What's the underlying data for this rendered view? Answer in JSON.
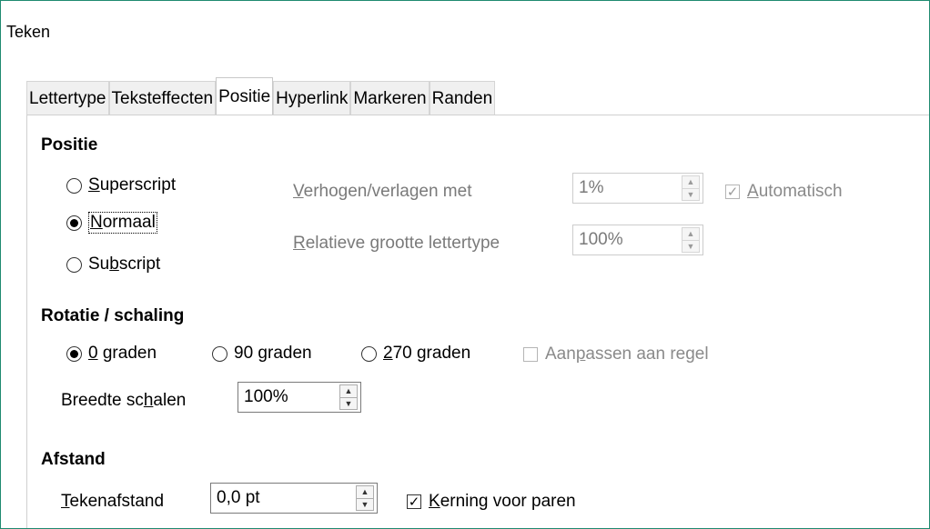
{
  "window": {
    "title": "Teken"
  },
  "tabs": [
    {
      "label": "Lettertype",
      "active": false
    },
    {
      "label": "Teksteffecten",
      "active": false
    },
    {
      "label": "Positie",
      "active": true
    },
    {
      "label": "Hyperlink",
      "active": false
    },
    {
      "label": "Markeren",
      "active": false
    },
    {
      "label": "Randen",
      "active": false
    }
  ],
  "positie": {
    "title": "Positie",
    "superscript": {
      "pre": "",
      "key": "S",
      "post": "uperscript"
    },
    "normaal": {
      "pre": "",
      "key": "N",
      "post": "ormaal"
    },
    "subscript": {
      "pre": "Su",
      "key": "b",
      "post": "script"
    },
    "selected": "Normaal",
    "raise": {
      "key": "V",
      "post": "erhogen/verlagen met",
      "value": "1%"
    },
    "relsize": {
      "key": "R",
      "post": "elatieve grootte lettertype",
      "value": "100%"
    },
    "auto": {
      "key": "A",
      "post": "utomatisch",
      "checked": true
    }
  },
  "rotatie": {
    "title": "Rotatie / schaling",
    "r0": {
      "key": "0",
      "post": " graden"
    },
    "r90": {
      "pre": "90 ",
      "key": "g",
      "post": "raden"
    },
    "r270": {
      "key": "2",
      "post": "70 graden"
    },
    "selected": "0 graden",
    "fit": {
      "pre": "Aan",
      "key": "p",
      "post": "assen aan regel",
      "checked": false
    },
    "scale": {
      "pre": "Breedte sc",
      "key": "h",
      "post": "alen",
      "value": "100%"
    }
  },
  "afstand": {
    "title": "Afstand",
    "spacing": {
      "key": "T",
      "post": "ekenafstand",
      "value": "0,0 pt"
    },
    "kerning": {
      "key": "K",
      "post": "erning voor paren",
      "checked": true
    }
  }
}
